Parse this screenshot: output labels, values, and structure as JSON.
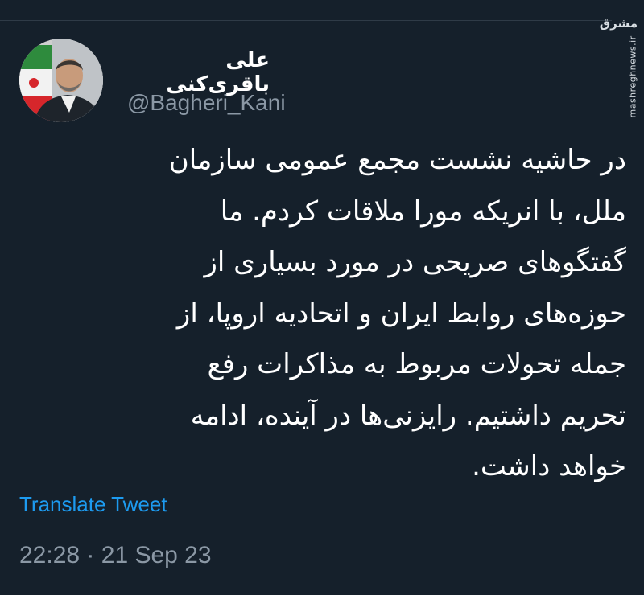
{
  "watermark": {
    "logo_text": "مشرق",
    "url": "mashreghnews.ir"
  },
  "author": {
    "display_name": "علی باقری‌کنی",
    "handle": "@Bagheri_Kani"
  },
  "tweet": {
    "lines": [
      "در حاشیه نشست مجمع عمومی سازمان",
      "ملل، با انریکه مورا ملاقات کردم. ما",
      "گفتگوهای صریحی در مورد بسیاری از",
      "حوزه‌های روابط ایران و اتحادیه اروپا، از",
      "جمله تحولات مربوط به مذاکرات رفع",
      "تحریم داشتیم. رایزنی‌ها در آینده، ادامه",
      "خواهد داشت."
    ],
    "translate_label": "Translate Tweet",
    "time": "22:28",
    "separator": "·",
    "date": "21 Sep 23"
  },
  "colors": {
    "background": "#15202b",
    "link": "#1d9bf0",
    "secondary_text": "#8b98a5"
  }
}
